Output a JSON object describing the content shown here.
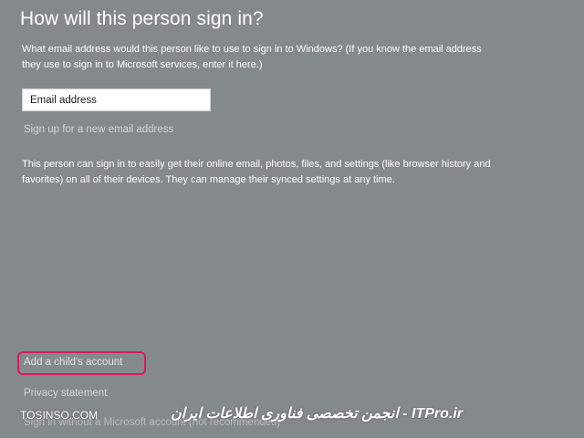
{
  "heading": "How will this person sign in?",
  "prompt_text": "What email address would this person like to use to sign in to Windows? (If you know the email address they use to sign in to Microsoft services, enter it here.)",
  "email_field": {
    "placeholder": "Email address",
    "value": ""
  },
  "signup_link": "Sign up for a new email address",
  "info_text": "This person can sign in to easily get their online email, photos, files, and settings (like browser history and favorites) on all of their devices. They can manage their synced settings at any time.",
  "child_account_link": "Add a child's account",
  "privacy_link": "Privacy statement",
  "no_msa_link": "Sign in without a Microsoft account (not recommended)",
  "highlight_color": "#d81b60",
  "watermark": {
    "left": "TOSINSO.COM",
    "right": "انجمن تخصصی فناوری اطلاعات ایران - ITPro.ir"
  }
}
